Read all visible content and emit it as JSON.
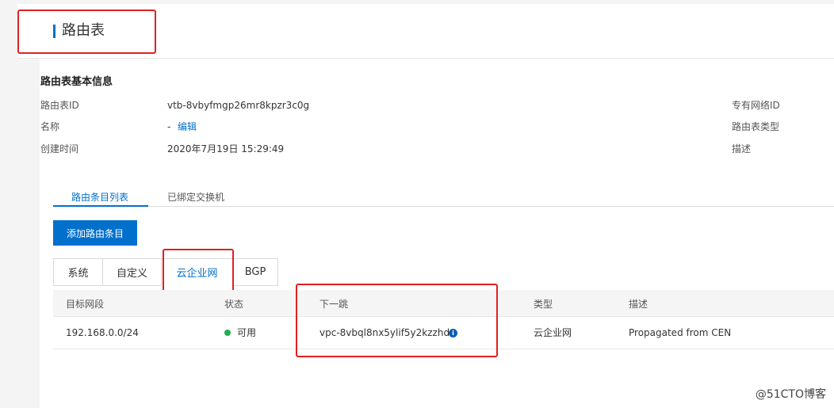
{
  "header": {
    "title": "路由表"
  },
  "basic_info": {
    "section_title": "路由表基本信息",
    "left_fields": [
      {
        "label": "路由表ID",
        "value": "vtb-8vbyfmgp26mr8kpzr3c0g"
      },
      {
        "label": "名称",
        "value": "-",
        "action": "编辑"
      },
      {
        "label": "创建时间",
        "value": "2020年7月19日 15:29:49"
      }
    ],
    "right_fields": [
      {
        "label": "专有网络ID"
      },
      {
        "label": "路由表类型"
      },
      {
        "label": "描述"
      }
    ]
  },
  "tabs": [
    {
      "label": "路由条目列表",
      "active": true
    },
    {
      "label": "已绑定交换机",
      "active": false
    }
  ],
  "add_button": "添加路由条目",
  "sub_tabs": [
    {
      "label": "系统"
    },
    {
      "label": "自定义"
    },
    {
      "label": "云企业网",
      "active": true
    },
    {
      "label": "BGP"
    }
  ],
  "table": {
    "columns": [
      "目标网段",
      "状态",
      "下一跳",
      "类型",
      "描述"
    ],
    "rows": [
      {
        "destination": "192.168.0.0/24",
        "status": "可用",
        "next_hop": "vpc-8vbql8nx5ylif5y2kzzhd",
        "type": "云企业网",
        "description": "Propagated from CEN"
      }
    ]
  },
  "colors": {
    "accent": "#0070cc",
    "highlight": "#e02020",
    "status_ok": "#22b14c"
  },
  "watermark": "@51CTO博客"
}
